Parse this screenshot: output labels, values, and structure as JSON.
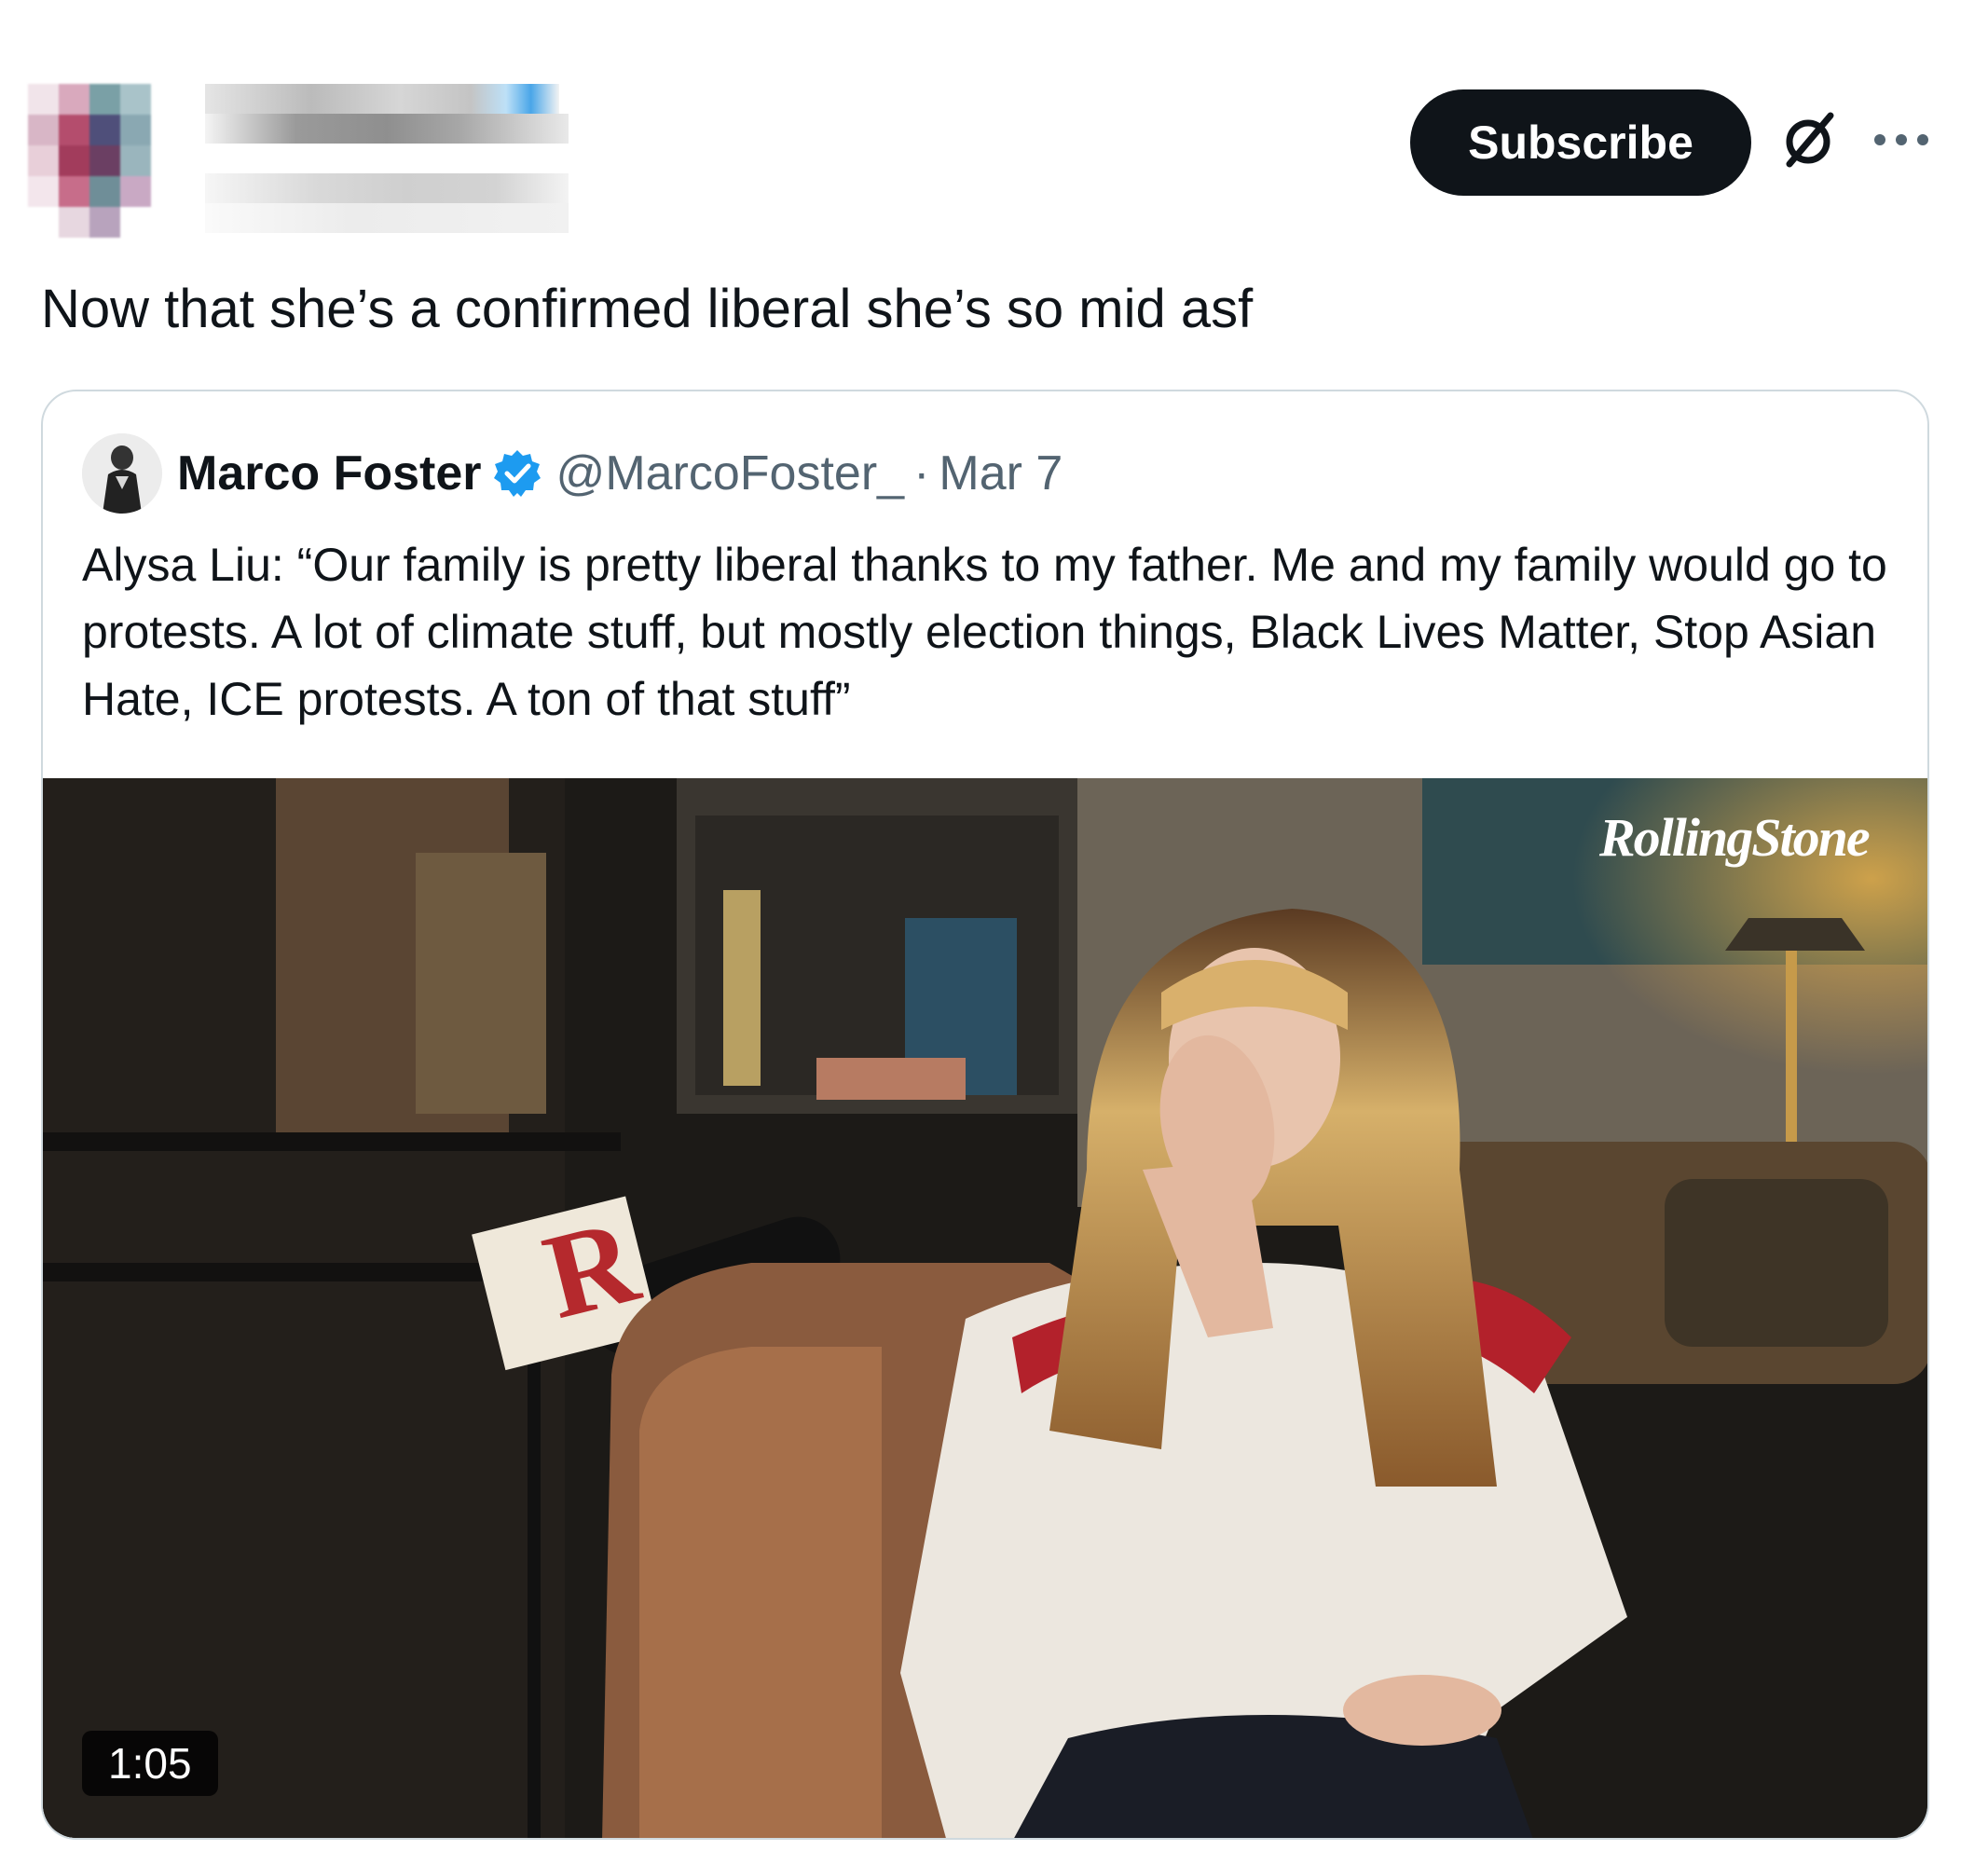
{
  "post": {
    "text": "Now that she’s a confirmed liberal she’s so mid asf",
    "author_obscured": true
  },
  "actions": {
    "subscribe_label": "Subscribe",
    "grok_icon": "grok-slash-circle-icon",
    "more_icon": "more-dots-icon"
  },
  "quoted_post": {
    "name": "Marco Foster",
    "verified": true,
    "handle": "@MarcoFoster_",
    "separator": "·",
    "date": "Mar 7",
    "text": "Alysa Liu: “Our family is pretty liberal thanks to my father. Me and my family would go to protests. A lot of climate stuff, but mostly election things, Black Lives Matter, Stop Asian Hate, ICE protests. A ton of that stuff”",
    "media": {
      "kind": "video",
      "duration": "1:05",
      "watermark": "RollingStone",
      "mic_flag_letter": "R"
    }
  },
  "colors": {
    "button_bg": "#0f1419",
    "secondary_text": "#536471",
    "verified_blue": "#1d9bf0",
    "card_border": "#cfd9de"
  }
}
